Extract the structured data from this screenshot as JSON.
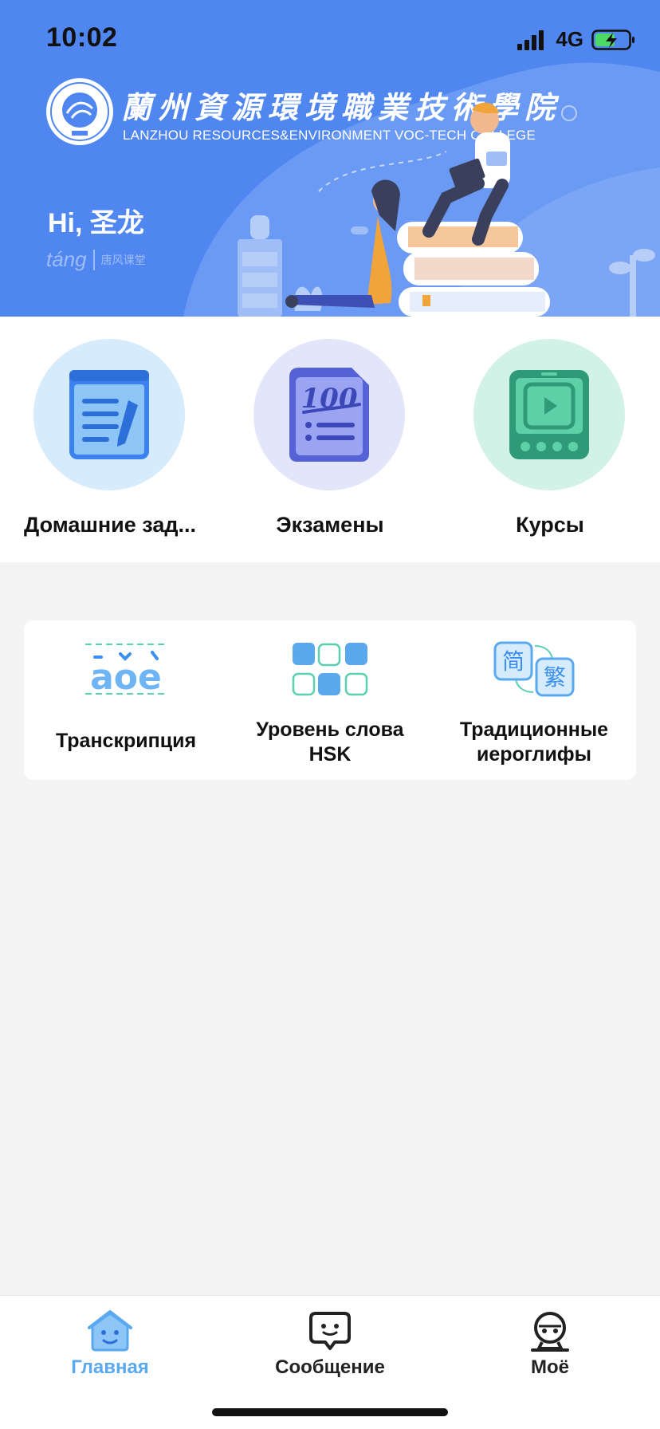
{
  "status_bar": {
    "time": "10:02",
    "network": "4G",
    "signal_icon": "signal-bars-icon",
    "battery_icon": "battery-charging-icon"
  },
  "banner": {
    "college_name_cn": "蘭州資源環境職業技術學院",
    "college_name_en": "LANZHOU RESOURCES&ENVIRONMENT VOC-TECH COLLEGE",
    "greeting": "Hi, 圣龙",
    "brand": "táng",
    "brand_sub": "唐风课堂",
    "background_color": "#4f86f0"
  },
  "main_shortcuts": [
    {
      "label": "Домашние зад...",
      "icon": "homework-notepad-icon",
      "circle_color": "#d6ebfb"
    },
    {
      "label": "Экзамены",
      "icon": "exam-100-icon",
      "circle_color": "#e3e6fa"
    },
    {
      "label": "Курсы",
      "icon": "course-video-tablet-icon",
      "circle_color": "#d2f2e8"
    }
  ],
  "tools": [
    {
      "label": "Транскрипция",
      "icon": "pinyin-aoe-icon"
    },
    {
      "label_line1": "Уровень слова",
      "label_line2": "HSK",
      "icon": "hsk-grid-icon"
    },
    {
      "label_line1": "Традиционные",
      "label_line2": "иероглифы",
      "icon": "simplified-traditional-icon",
      "glyph1": "简",
      "glyph2": "繁"
    }
  ],
  "bottom_nav": [
    {
      "label": "Главная",
      "icon": "home-icon",
      "active": true
    },
    {
      "label": "Сообщение",
      "icon": "message-bubble-icon",
      "active": false
    },
    {
      "label": "Моё",
      "icon": "profile-robot-icon",
      "active": false
    }
  ],
  "colors": {
    "accent": "#5aa8ee",
    "page_background": "#f4f4f4"
  }
}
